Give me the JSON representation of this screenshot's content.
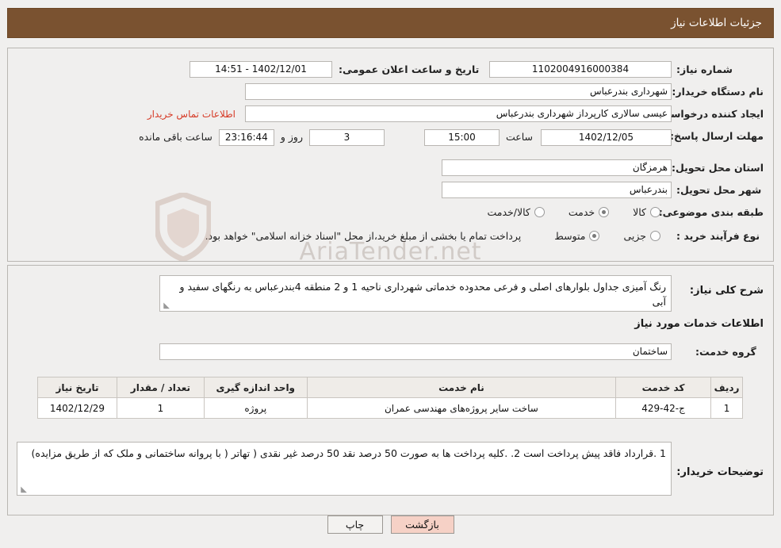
{
  "header": {
    "title": "جزئیات اطلاعات نیاز"
  },
  "form": {
    "need_number_label": "شماره نیاز:",
    "need_number_value": "1102004916000384",
    "public_announce_label": "تاریخ و ساعت اعلان عمومی:",
    "public_announce_value": "1402/12/01 - 14:51",
    "buyer_org_label": "نام دستگاه خریدار:",
    "buyer_org_value": "شهرداری بندرعباس",
    "creator_label": "ایجاد کننده درخواست:",
    "creator_value": "عیسی سالاری کارپرداز شهرداری بندرعباس",
    "contact_link": "اطلاعات تماس خریدار",
    "deadline_label": "مهلت ارسال پاسخ: تا تاریخ:",
    "deadline_date": "1402/12/05",
    "hour_label": "ساعت",
    "deadline_time": "15:00",
    "days_value": "3",
    "days_label": "روز و",
    "remaining_value": "23:16:44",
    "remaining_label": "ساعت باقی مانده",
    "province_label": "استان محل تحویل:",
    "province_value": "هرمزگان",
    "city_label": "شهر محل تحویل:",
    "city_value": "بندرعباس",
    "category_label": "طبقه بندی موضوعی:",
    "category_options": [
      {
        "label": "کالا",
        "selected": false
      },
      {
        "label": "خدمت",
        "selected": true
      },
      {
        "label": "کالا/خدمت",
        "selected": false
      }
    ],
    "process_label": "نوع فرآیند خرید :",
    "process_options": [
      {
        "label": "جزیی",
        "selected": false
      },
      {
        "label": "متوسط",
        "selected": true
      }
    ],
    "process_note": "پرداخت تمام یا بخشی از مبلغ خرید،از محل \"اسناد خزانه اسلامی\" خواهد بود."
  },
  "details": {
    "general_desc_label": "شرح کلی نیاز:",
    "general_desc_value": "رنگ آمیزی جداول بلوارهای اصلی و فرعی محدوده خدماتی شهرداری ناحیه 1 و 2 منطقه 4بندرعباس به رنگهای سفید و آبی",
    "services_info_title": "اطلاعات خدمات مورد نیاز",
    "service_group_label": "گروه خدمت:",
    "service_group_value": "ساختمان",
    "table": {
      "columns": [
        "ردیف",
        "کد خدمت",
        "نام خدمت",
        "واحد اندازه گیری",
        "تعداد / مقدار",
        "تاریخ نیاز"
      ],
      "rows": [
        {
          "row": "1",
          "code": "ج-42-429",
          "name": "ساخت سایر پروژه‌های مهندسی عمران",
          "unit": "پروژه",
          "qty": "1",
          "date": "1402/12/29"
        }
      ]
    },
    "buyer_notes_label": "توضیحات خریدار:",
    "buyer_notes_value": "1 .قرارداد فاقد پیش پرداخت است 2. .کلیه پرداخت ها به صورت 50 درصد نقد 50 درصد غیر نقدی ( تهاتر ( با پروانه ساختمانی و ملک که از طریق مزایده)"
  },
  "footer": {
    "print_label": "چاپ",
    "back_label": "بازگشت"
  },
  "watermark": {
    "text": "AriaTender.net"
  }
}
